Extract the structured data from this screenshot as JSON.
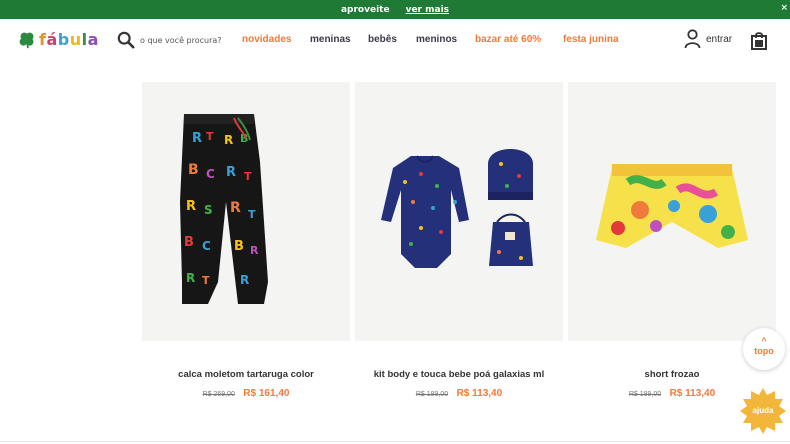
{
  "announcement": {
    "text": "aproveite",
    "link": "ver mais",
    "close": "×"
  },
  "logo": {
    "text": "fábula",
    "letter_colors": [
      "#e8912a",
      "#d33c6e",
      "#3aa0d8",
      "#f0b817",
      "#3a8f3e",
      "#8b4fb6"
    ]
  },
  "search": {
    "placeholder": "o que você procura?"
  },
  "nav": [
    {
      "label": "novidades",
      "style": "accent"
    },
    {
      "label": "meninas",
      "style": "dark"
    },
    {
      "label": "bebês",
      "style": "dark"
    },
    {
      "label": "meninos",
      "style": "dark"
    },
    {
      "label": "bazar até 60%",
      "style": "accent"
    },
    {
      "label": "festa junina",
      "style": "accent"
    }
  ],
  "account": {
    "label": "entrar"
  },
  "products": [
    {
      "name": "calca moletom tartaruga color",
      "old_price": "R$ 269,00",
      "price": "R$ 161,40"
    },
    {
      "name": "kit body e touca bebe poá galaxias ml",
      "old_price": "R$ 189,00",
      "price": "R$ 113,40"
    },
    {
      "name": "short frozao",
      "old_price": "R$ 189,00",
      "price": "R$ 113,40"
    }
  ],
  "back_to_top": {
    "arrow": "^",
    "label": "topo"
  },
  "help": {
    "label": "ajuda"
  },
  "colors": {
    "green": "#1e7a35",
    "accent": "#f07a3c",
    "text": "#333333"
  }
}
